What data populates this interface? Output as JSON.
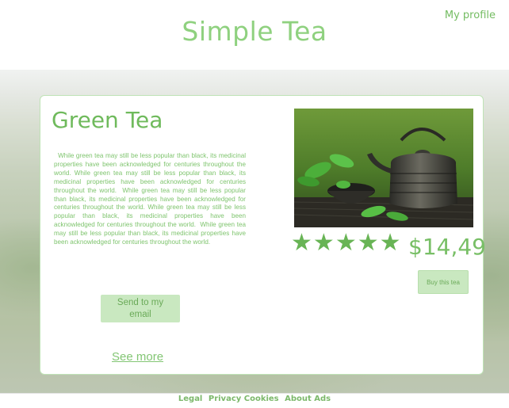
{
  "header": {
    "site_title": "Simple Tea",
    "profile_link": "My profile"
  },
  "product": {
    "name": "Green Tea",
    "description": "  While green tea may still be less popular than black, its medicinal properties have been acknowledged for centuries throughout the world. While green tea may still be less popular than black, its medicinal properties have been acknowledged for centuries throughout the world.  While green tea may still be less popular than black, its medicinal properties have been acknowledged for centuries throughout the world. While green tea may still be less popular than black, its medicinal properties have been acknowledged for centuries throughout the world.  While green tea may still be less popular than black, its medicinal properties have been acknowledged for centuries throughout the world.",
    "rating": 5,
    "rating_max": 5,
    "price": "$14,49",
    "image_icon": "teapot-photo"
  },
  "actions": {
    "send_email_label": "Send to my email",
    "see_more_label": "See more",
    "buy_label": "Buy this tea"
  },
  "footer": {
    "links": [
      "Legal",
      "Privacy Cookies",
      "About Ads"
    ]
  },
  "colors": {
    "accent_green": "#6fba5c",
    "button_bg": "#c9e8c0",
    "star_color": "#68b455"
  }
}
